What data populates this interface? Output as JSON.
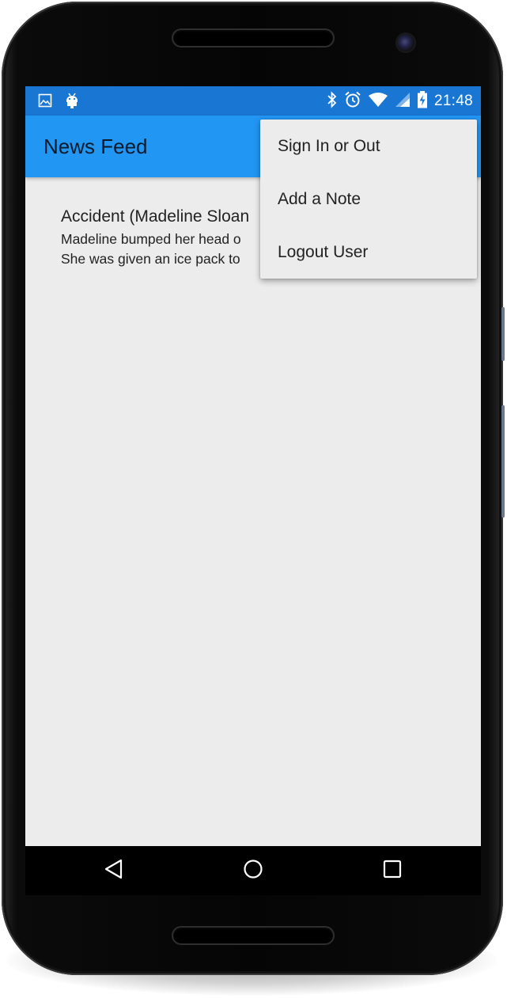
{
  "status_bar": {
    "time": "21:48",
    "icons": [
      "image-icon",
      "android-icon",
      "bluetooth-icon",
      "alarm-icon",
      "wifi-icon",
      "signal-icon",
      "battery-charging-icon"
    ]
  },
  "toolbar": {
    "title": "News Feed"
  },
  "feed": {
    "items": [
      {
        "title": "Accident (Madeline Sloan",
        "body_line1": "Madeline bumped her head o",
        "body_line2": "She was given an ice pack to"
      }
    ]
  },
  "overflow_menu": {
    "items": [
      {
        "label": "Sign In or Out"
      },
      {
        "label": "Add a Note"
      },
      {
        "label": "Logout User"
      }
    ]
  },
  "nav_bar": {
    "icons": [
      "back-icon",
      "home-icon",
      "recents-icon"
    ]
  },
  "colors": {
    "status_bar": "#1976d2",
    "toolbar": "#2196f3",
    "screen_background": "#ececec"
  }
}
